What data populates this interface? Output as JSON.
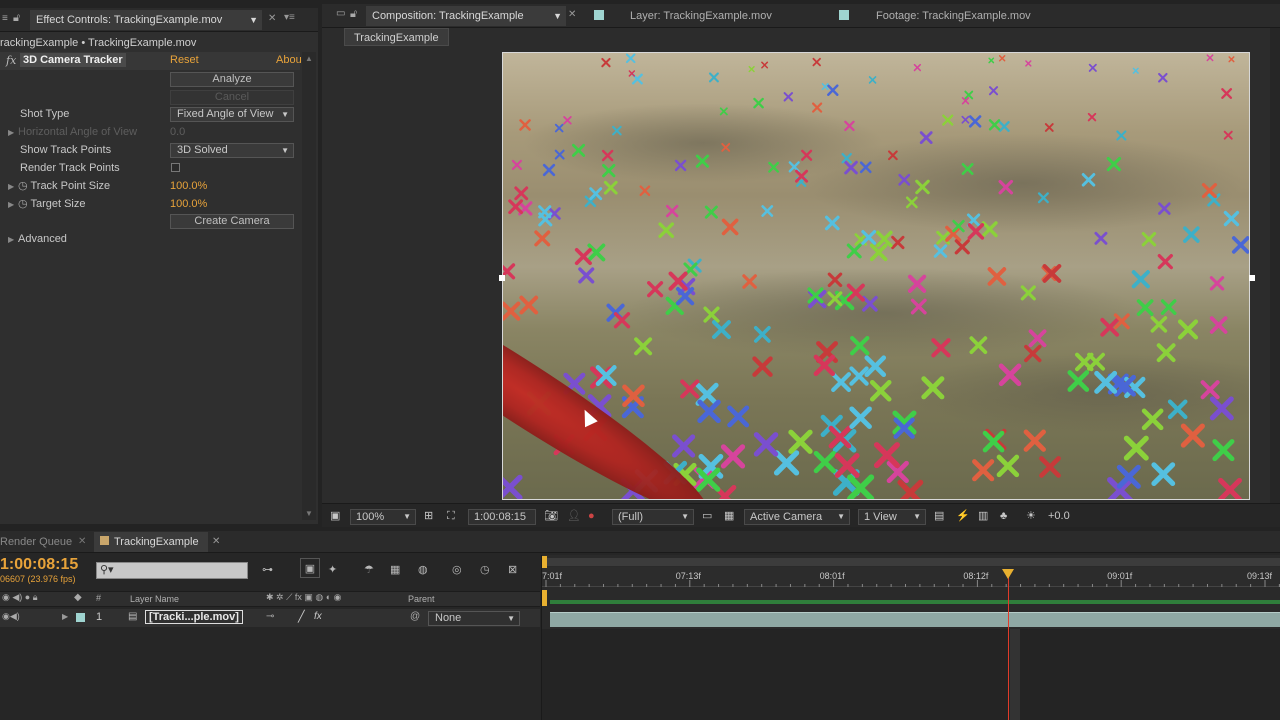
{
  "effect_panel": {
    "tab_title": "Effect Controls: TrackingExample.mov",
    "breadcrumb": "rackingExample • TrackingExample.mov",
    "effect_name": "3D Camera Tracker",
    "reset_label": "Reset",
    "about_label": "Abou",
    "analyze_label": "Analyze",
    "cancel_label": "Cancel",
    "fx_icon": "fx",
    "props": {
      "shot_type_label": "Shot Type",
      "shot_type_value": "Fixed Angle of View",
      "hfov_label": "Horizontal Angle of View",
      "hfov_value": "0.0",
      "show_track_points_label": "Show Track Points",
      "show_track_points_value": "3D Solved",
      "render_track_points_label": "Render Track Points",
      "track_point_size_label": "Track Point Size",
      "track_point_size_value": "100.0%",
      "target_size_label": "Target Size",
      "target_size_value": "100.0%",
      "create_camera_label": "Create Camera",
      "advanced_label": "Advanced"
    }
  },
  "comp_tabs": {
    "composition": "Composition: TrackingExample",
    "layer": "Layer: TrackingExample.mov",
    "footage": "Footage: TrackingExample.mov",
    "comp_button": "TrackingExample"
  },
  "viewer_toolbar": {
    "zoom": "100%",
    "timecode": "1:00:08:15",
    "resolution": "(Full)",
    "camera": "Active Camera",
    "views": "1 View",
    "exposure": "+0.0"
  },
  "timeline": {
    "render_queue_tab": "Render Queue",
    "comp_tab": "TrackingExample",
    "current_time": "1:00:08:15",
    "frame_info": "06607 (23.976 fps)",
    "search_placeholder": "",
    "col_layer_name": "Layer Name",
    "col_parent": "Parent",
    "ruler": [
      "7:01f",
      "07:13f",
      "08:01f",
      "08:12f",
      "09:01f",
      "09:13f"
    ],
    "playhead_fraction": 0.63,
    "layers": [
      {
        "index": "1",
        "name": "[Tracki...ple.mov]",
        "parent": "None"
      }
    ]
  },
  "colors": {
    "accent_orange": "#e8a33a",
    "playhead": "#e03b2a",
    "layer_bar": "#8fa8a4"
  }
}
